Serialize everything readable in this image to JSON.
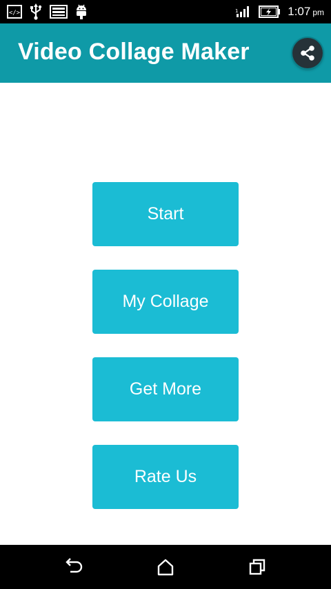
{
  "status_bar": {
    "left_icons": [
      "code-icon",
      "usb-icon",
      "image-icon",
      "android-icon"
    ],
    "right_icons": [
      "signal-icon",
      "battery-icon"
    ],
    "time": "1:07",
    "ampm": "pm"
  },
  "app_bar": {
    "title": "Video Collage Maker",
    "color": "#0f9aa7",
    "share_icon": "share-icon"
  },
  "menu": {
    "button_color": "#1bbcd4",
    "start": "Start",
    "my_collage": "My Collage",
    "get_more": "Get More",
    "rate_us": "Rate Us"
  },
  "nav_bar": {
    "icons": [
      "back-icon",
      "home-icon",
      "recents-icon"
    ]
  }
}
